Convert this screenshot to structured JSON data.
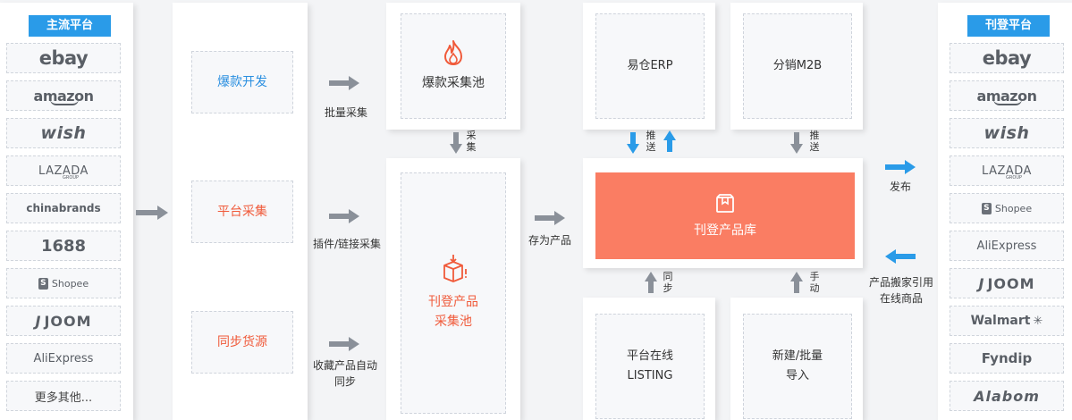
{
  "left_panel": {
    "title": "主流平台",
    "logos": [
      {
        "label": "ebay",
        "icon": "ebay-logo"
      },
      {
        "label": "amazon",
        "icon": "amazon-logo"
      },
      {
        "label": "wish",
        "icon": "wish-logo"
      },
      {
        "label": "LAZADA",
        "sub": "GROUP",
        "icon": "lazada-logo"
      },
      {
        "label": "chinabrands",
        "icon": "chinabrands-logo"
      },
      {
        "label": "1688",
        "icon": "1688-logo"
      },
      {
        "label": "Shopee",
        "icon": "shopee-logo"
      },
      {
        "label": "JOOM",
        "icon": "joom-logo"
      },
      {
        "label": "AliExpress",
        "icon": "aliexpress-logo"
      },
      {
        "label": "更多其他...",
        "icon": ""
      }
    ]
  },
  "collection": {
    "items": [
      "爆款开发",
      "平台采集",
      "同步货源"
    ],
    "arrow_labels": [
      "批量采集",
      "插件/链接采集",
      "收藏产品自动\n同步"
    ]
  },
  "pools": {
    "hot_pool": "爆款采集池",
    "collect_pool": "刊登产品\n采集池",
    "collect_arrow": "采\n集",
    "save_label": "存为产品"
  },
  "center": {
    "erp": "易仓ERP",
    "m2b": "分销M2B",
    "push_left": "推\n送",
    "push_right": "推\n送",
    "library": "刊登产品库",
    "sync": "同\n步",
    "manual": "手\n动",
    "listing": "平台在线\nLISTING",
    "new_import": "新建/批量\n导入"
  },
  "right_flow": {
    "publish": "发布",
    "move": "产品搬家引用\n在线商品"
  },
  "right_panel": {
    "title": "刊登平台",
    "logos": [
      {
        "label": "ebay",
        "icon": "ebay-logo"
      },
      {
        "label": "amazon",
        "icon": "amazon-logo"
      },
      {
        "label": "wish",
        "icon": "wish-logo"
      },
      {
        "label": "LAZADA",
        "sub": "GROUP",
        "icon": "lazada-logo"
      },
      {
        "label": "Shopee",
        "icon": "shopee-logo"
      },
      {
        "label": "AliExpress",
        "icon": "aliexpress-logo"
      },
      {
        "label": "JOOM",
        "icon": "joom-logo"
      },
      {
        "label": "Walmart",
        "icon": "walmart-logo"
      },
      {
        "label": "Fyndip",
        "icon": "fyndip-logo"
      },
      {
        "label": "Alabom",
        "icon": "alabom-logo"
      }
    ]
  },
  "colors": {
    "accent_blue": "#2a9be8",
    "library_orange": "#fa7d63",
    "hot_text_blue": "#2a8fe0",
    "orange_text": "#f05a3a",
    "gray_arrow": "#8a9099"
  }
}
